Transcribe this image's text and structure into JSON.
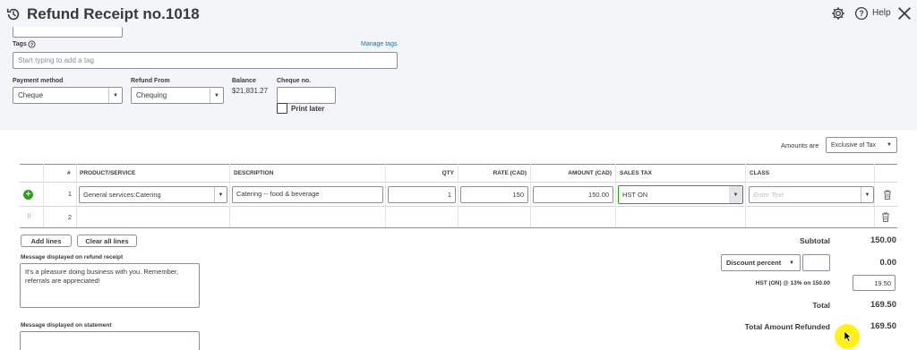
{
  "header": {
    "title": "Refund Receipt no.1018",
    "help_label": "Help"
  },
  "tags": {
    "label": "Tags",
    "manage_link": "Manage tags",
    "placeholder": "Start typing to add a tag"
  },
  "payment": {
    "payment_method_label": "Payment method",
    "payment_method_value": "Cheque",
    "refund_from_label": "Refund From",
    "refund_from_value": "Chequing",
    "balance_label": "Balance",
    "balance_value": "$21,831.27",
    "cheque_no_label": "Cheque no.",
    "cheque_no_value": "",
    "print_later_label": "Print later"
  },
  "amounts": {
    "label": "Amounts are",
    "value": "Exclusive of Tax"
  },
  "table": {
    "headers": [
      "#",
      "PRODUCT/SERVICE",
      "DESCRIPTION",
      "QTY",
      "RATE (CAD)",
      "AMOUNT (CAD)",
      "SALES TAX",
      "CLASS"
    ],
    "rows": [
      {
        "num": "1",
        "product": "General services:Catering",
        "description": "Catering -- food & beverage",
        "qty": "1",
        "rate": "150",
        "amount": "150.00",
        "sales_tax": "HST ON",
        "class_placeholder": "Enter Text"
      },
      {
        "num": "2",
        "product": "",
        "description": "",
        "qty": "",
        "rate": "",
        "amount": "",
        "sales_tax": "",
        "class_placeholder": ""
      }
    ]
  },
  "buttons": {
    "add_lines": "Add lines",
    "clear_all_lines": "Clear all lines"
  },
  "messages": {
    "receipt_label": "Message displayed on refund receipt",
    "receipt_text": "It's a pleasure doing business with you.  Remember, referrals are appreciated!",
    "statement_label": "Message displayed on statement"
  },
  "totals": {
    "subtotal_label": "Subtotal",
    "subtotal_value": "150.00",
    "discount_select": "Discount percent",
    "discount_value": "0.00",
    "tax_label": "HST (ON) @ 13% on 150.00",
    "tax_value": "19.50",
    "total_label": "Total",
    "total_value": "169.50",
    "refunded_label": "Total Amount Refunded",
    "refunded_value": "169.50"
  },
  "colors": {
    "header_bg": "#f4f5f8",
    "accent_green": "#2ca01c",
    "link_blue": "#0077c5",
    "cursor_highlight": "#ffef00"
  }
}
